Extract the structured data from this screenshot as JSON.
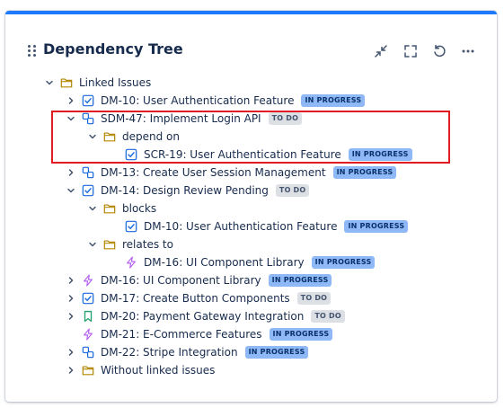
{
  "widget": {
    "title": "Dependency Tree",
    "accent_color": "#1d7afc",
    "header_actions": [
      {
        "name": "collapse-icon"
      },
      {
        "name": "fullscreen-icon"
      },
      {
        "name": "refresh-icon"
      },
      {
        "name": "more-icon"
      }
    ]
  },
  "tree": [
    {
      "label": "Linked Issues",
      "icon": "folder-icon",
      "chevron": "down",
      "status": "",
      "status_type": ""
    },
    {
      "label": "DM-10: User Authentication Feature",
      "icon": "checkbox-icon",
      "chevron": "right",
      "status": "IN PROGRESS",
      "status_type": "prog"
    },
    {
      "label": "SDM-47: Implement Login API",
      "icon": "subtask-icon",
      "chevron": "down",
      "status": "TO DO",
      "status_type": "todo"
    },
    {
      "label": "depend on",
      "icon": "folder-icon",
      "chevron": "down",
      "status": "",
      "status_type": ""
    },
    {
      "label": "SCR-19: User Authentication Feature",
      "icon": "checkbox-icon",
      "chevron": "none",
      "status": "IN PROGRESS",
      "status_type": "prog"
    },
    {
      "label": "DM-13: Create User Session Management",
      "icon": "subtask-icon",
      "chevron": "right",
      "status": "IN PROGRESS",
      "status_type": "prog"
    },
    {
      "label": "DM-14: Design Review Pending",
      "icon": "checkbox-icon",
      "chevron": "down",
      "status": "TO DO",
      "status_type": "todo"
    },
    {
      "label": "blocks",
      "icon": "folder-icon",
      "chevron": "down",
      "status": "",
      "status_type": ""
    },
    {
      "label": "DM-10: User Authentication Feature",
      "icon": "checkbox-icon",
      "chevron": "none",
      "status": "IN PROGRESS",
      "status_type": "prog"
    },
    {
      "label": "relates to",
      "icon": "folder-icon",
      "chevron": "down",
      "status": "",
      "status_type": ""
    },
    {
      "label": "DM-16: UI Component Library",
      "icon": "epic-icon",
      "chevron": "none",
      "status": "IN PROGRESS",
      "status_type": "prog"
    },
    {
      "label": "DM-16: UI Component Library",
      "icon": "epic-icon",
      "chevron": "right",
      "status": "IN PROGRESS",
      "status_type": "prog"
    },
    {
      "label": "DM-17: Create Button Components",
      "icon": "checkbox-icon",
      "chevron": "right",
      "status": "TO DO",
      "status_type": "todo"
    },
    {
      "label": "DM-20: Payment Gateway Integration",
      "icon": "bookmark-icon",
      "chevron": "right",
      "status": "TO DO",
      "status_type": "todo"
    },
    {
      "label": "DM-21: E-Commerce Features",
      "icon": "epic-icon",
      "chevron": "none",
      "status": "IN PROGRESS",
      "status_type": "prog"
    },
    {
      "label": "DM-22: Stripe Integration",
      "icon": "subtask-icon",
      "chevron": "right",
      "status": "IN PROGRESS",
      "status_type": "prog"
    },
    {
      "label": "Without linked issues",
      "icon": "folder-icon",
      "chevron": "right",
      "status": "",
      "status_type": ""
    }
  ]
}
